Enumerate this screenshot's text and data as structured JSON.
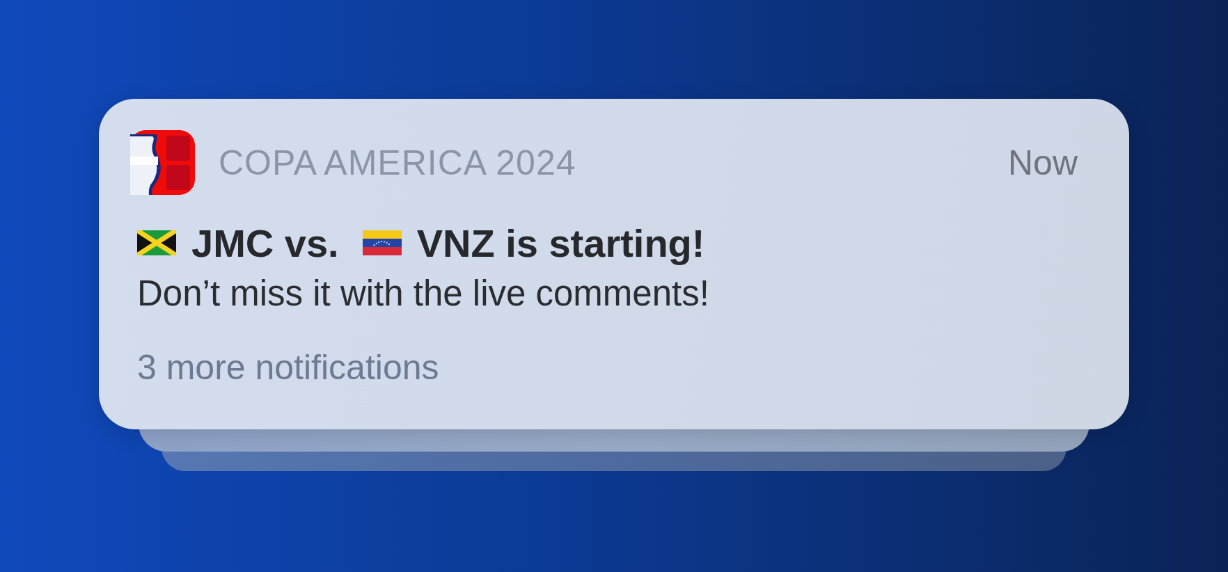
{
  "notification": {
    "app_name": "COPA AMERICA 2024",
    "time": "Now",
    "title_parts": [
      {
        "kind": "flag_jamaica"
      },
      {
        "kind": "text",
        "text": "JMC vs."
      },
      {
        "kind": "flag_venezuela"
      },
      {
        "kind": "text",
        "text": "VNZ is starting!"
      }
    ],
    "body": "Don’t miss it with the live comments!",
    "more": "3 more notifications"
  }
}
